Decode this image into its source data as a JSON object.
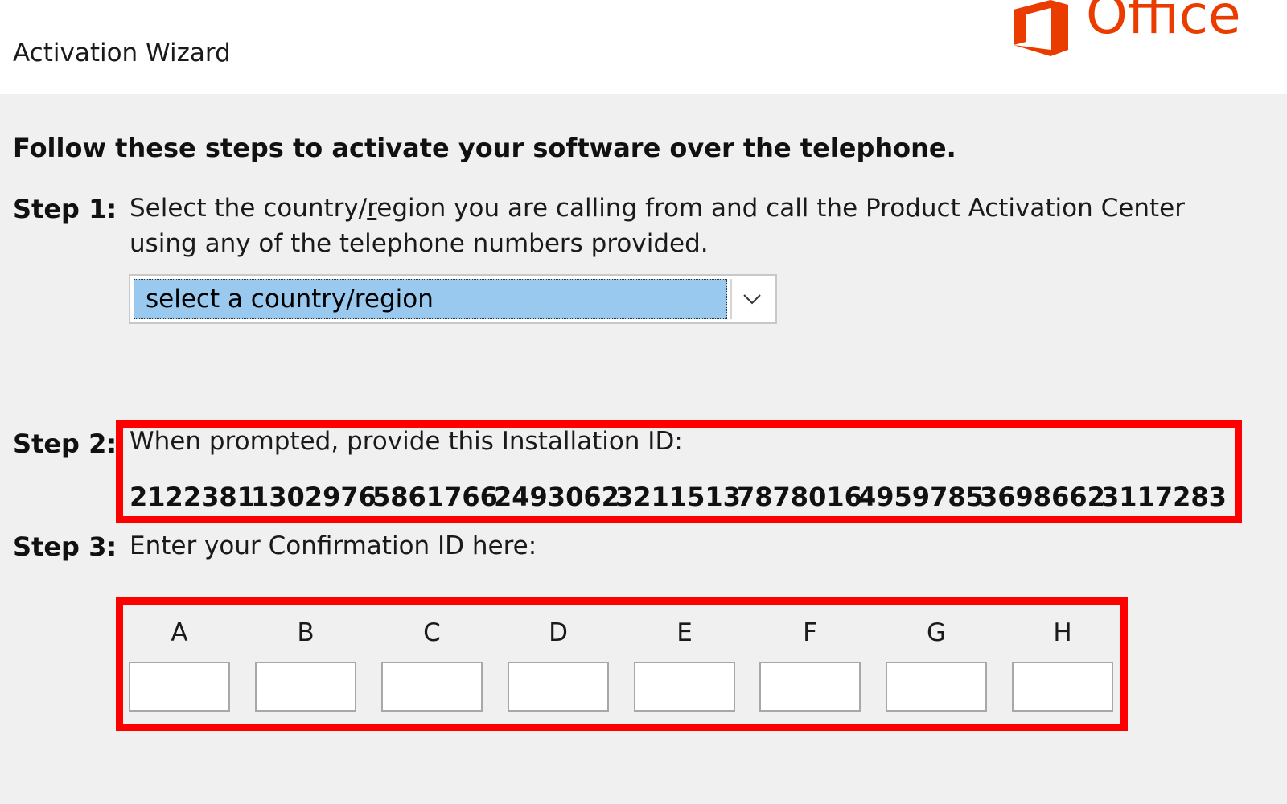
{
  "header": {
    "title": "Activation Wizard",
    "brand": "Office",
    "brand_color": "#eb3c00",
    "logo_icon": "office-logo-icon"
  },
  "instructions": "Follow these steps to activate your software over the telephone.",
  "step1": {
    "label": "Step 1:",
    "text_before_key": "Select the country/",
    "text_key": "r",
    "text_after_key": "egion you are calling from and call the Product Activation Center",
    "text_line2": "using any of the telephone numbers provided.",
    "select_value": "select a country/region",
    "select_icon": "chevron-down-icon"
  },
  "step2": {
    "label": "Step 2:",
    "text": "When prompted, provide this Installation ID:",
    "installation_id": [
      "2122381",
      "1302976",
      "5861766",
      "2493062",
      "3211513",
      "7878016",
      "4959785",
      "3698662",
      "3117283"
    ]
  },
  "step3": {
    "label": "Step 3:",
    "text": "Enter your Confirmation ID here:",
    "fields": [
      {
        "letter": "A",
        "value": ""
      },
      {
        "letter": "B",
        "value": ""
      },
      {
        "letter": "C",
        "value": ""
      },
      {
        "letter": "D",
        "value": ""
      },
      {
        "letter": "E",
        "value": ""
      },
      {
        "letter": "F",
        "value": ""
      },
      {
        "letter": "G",
        "value": ""
      },
      {
        "letter": "H",
        "value": ""
      }
    ]
  },
  "colors": {
    "highlight": "#ff0000",
    "selection": "#99c9ef"
  }
}
